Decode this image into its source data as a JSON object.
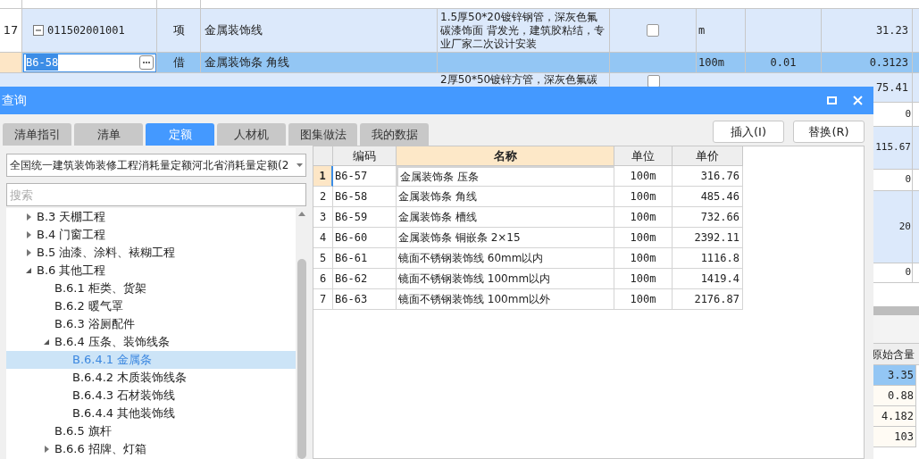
{
  "sheet": {
    "rows": [
      {
        "number": "17",
        "code": "011502001001",
        "expanded": true,
        "type": "项",
        "name": "金属装饰线",
        "description": "1.5厚50*20镀锌钢管，深灰色氟碳漆饰面 背发光，建筑胶粘结，专业厂家二次设计安装",
        "checked": false,
        "unit": "m",
        "amount": "31.23",
        "selected": false
      },
      {
        "code": "B6-58",
        "type": "借",
        "name": "金属装饰条 角线",
        "unit": "100m",
        "quantity": "0.01",
        "amount": "0.3123",
        "selected": true
      }
    ],
    "partial_row": {
      "description": "2厚50*50镀锌方管，深灰色氟碳",
      "checked": false,
      "amount": "75.41"
    },
    "more_amounts": [
      "0",
      "115.67",
      "0",
      "20",
      "0"
    ],
    "detail": {
      "header": "原始含量",
      "values": [
        {
          "text": "3.35",
          "selected": true
        },
        {
          "text": "0.88",
          "selected": false
        },
        {
          "text": "4.182",
          "selected": false
        },
        {
          "text": "103",
          "selected": false
        }
      ]
    }
  },
  "dialog": {
    "title": "查询",
    "tabs": [
      {
        "label": "清单指引",
        "selected": false
      },
      {
        "label": "清单",
        "selected": false
      },
      {
        "label": "定额",
        "selected": true
      },
      {
        "label": "人材机",
        "selected": false
      },
      {
        "label": "图集做法",
        "selected": false
      },
      {
        "label": "我的数据",
        "selected": false
      }
    ],
    "buttons": [
      "插入(I)",
      "替换(R)"
    ],
    "library": "全国统一建筑装饰装修工程消耗量定额河北省消耗量定额(2",
    "search": {
      "placeholder": "搜索"
    },
    "tree": [
      {
        "label": "B.3 天棚工程",
        "expanded": false,
        "selected": false
      },
      {
        "label": "B.4 门窗工程",
        "expanded": false,
        "selected": false
      },
      {
        "label": "B.5 油漆、涂料、裱糊工程",
        "expanded": false,
        "selected": false
      },
      {
        "label": "B.6 其他工程",
        "expanded": true,
        "selected": false,
        "children": [
          {
            "label": "B.6.1 柜类、货架",
            "selected": false
          },
          {
            "label": "B.6.2 暖气罩",
            "selected": false
          },
          {
            "label": "B.6.3 浴厕配件",
            "selected": false
          },
          {
            "label": "B.6.4 压条、装饰线条",
            "expanded": true,
            "selected": false,
            "children": [
              {
                "label": "B.6.4.1 金属条",
                "selected": true
              },
              {
                "label": "B.6.4.2 木质装饰线条",
                "selected": false
              },
              {
                "label": "B.6.4.3 石材装饰线",
                "selected": false
              },
              {
                "label": "B.6.4.4 其他装饰线",
                "selected": false
              }
            ]
          },
          {
            "label": "B.6.5 旗杆",
            "selected": false
          },
          {
            "label": "B.6.6 招牌、灯箱",
            "expanded": false,
            "selected": false
          }
        ]
      }
    ],
    "table": {
      "columns": [
        {
          "label": "编码",
          "selected": false
        },
        {
          "label": "名称",
          "selected": true
        },
        {
          "label": "单位",
          "selected": false
        },
        {
          "label": "单价",
          "selected": false
        }
      ],
      "rows": [
        {
          "number": "1",
          "code": "B6-57",
          "name": "金属装饰条 压条",
          "unit": "100m",
          "price": "316.76",
          "selected": true
        },
        {
          "number": "2",
          "code": "B6-58",
          "name": "金属装饰条 角线",
          "unit": "100m",
          "price": "485.46",
          "selected": false
        },
        {
          "number": "3",
          "code": "B6-59",
          "name": "金属装饰条 槽线",
          "unit": "100m",
          "price": "732.66",
          "selected": false
        },
        {
          "number": "4",
          "code": "B6-60",
          "name": "金属装饰条 铜嵌条 2×15",
          "unit": "100m",
          "price": "2392.11",
          "selected": false
        },
        {
          "number": "5",
          "code": "B6-61",
          "name": "镜面不锈钢装饰线 60mm以内",
          "unit": "100m",
          "price": "1116.8",
          "selected": false
        },
        {
          "number": "6",
          "code": "B6-62",
          "name": "镜面不锈钢装饰线 100mm以内",
          "unit": "100m",
          "price": "1419.4",
          "selected": false
        },
        {
          "number": "7",
          "code": "B6-63",
          "name": "镜面不锈钢装饰线 100mm以外",
          "unit": "100m",
          "price": "2176.87",
          "selected": false
        }
      ]
    }
  }
}
